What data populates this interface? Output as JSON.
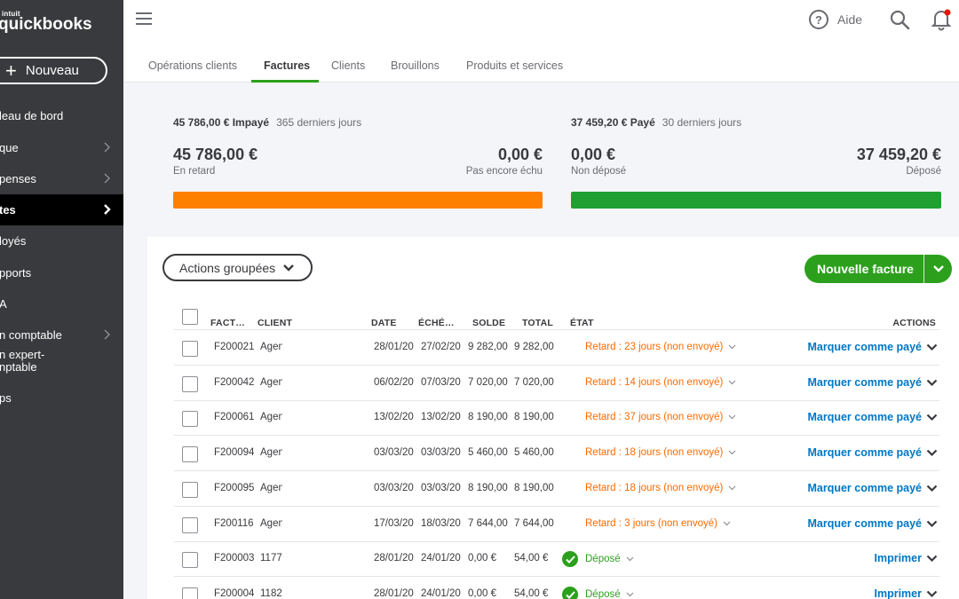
{
  "brand": {
    "intuit": "intuit",
    "name": "quickbooks"
  },
  "new_button": {
    "label": "Nouveau"
  },
  "sidebar": {
    "items": [
      {
        "label": "leau de bord",
        "chevron": false,
        "active": false
      },
      {
        "label": "que",
        "chevron": true,
        "active": false
      },
      {
        "label": "penses",
        "chevron": true,
        "active": false
      },
      {
        "label": "tes",
        "chevron": true,
        "active": true
      },
      {
        "label": "loyés",
        "chevron": false,
        "active": false
      },
      {
        "label": "pports",
        "chevron": false,
        "active": false
      },
      {
        "label": "A",
        "chevron": false,
        "active": false
      },
      {
        "label": "n comptable",
        "chevron": true,
        "active": false
      },
      {
        "label": "n expert-",
        "label2": "nptable",
        "chevron": false,
        "active": false
      },
      {
        "label": "ps",
        "chevron": false,
        "active": false
      }
    ]
  },
  "header": {
    "help_label": "Aide"
  },
  "tabs": [
    {
      "label": "Opérations clients"
    },
    {
      "label": "Factures"
    },
    {
      "label": "Clients"
    },
    {
      "label": "Brouillons"
    },
    {
      "label": "Produits et services"
    }
  ],
  "summary": {
    "unpaid": {
      "total": "45 786,00 € Impayé",
      "period": "365 derniers jours",
      "overdue_amount": "45 786,00 €",
      "overdue_label": "En retard",
      "not_due_amount": "0,00 €",
      "not_due_label": "Pas encore échu",
      "bar_color": "#ff8000"
    },
    "paid": {
      "total": "37 459,20 € Payé",
      "period": "30 derniers jours",
      "not_deposited_amount": "0,00 €",
      "not_deposited_label": "Non déposé",
      "deposited_amount": "37 459,20 €",
      "deposited_label": "Déposé",
      "bar_color": "#21a032"
    }
  },
  "toolbar": {
    "batch_label": "Actions groupées",
    "new_invoice_label": "Nouvelle facture"
  },
  "table": {
    "columns": [
      "FACT…",
      "CLIENT",
      "DATE",
      "ÉCHÉ…",
      "SOLDE",
      "TOTAL",
      "ÉTAT",
      "ACTIONS"
    ],
    "rows": [
      {
        "num": "F200021",
        "client": "Agen",
        "date": "28/01/20",
        "due": "27/02/20",
        "balance": "9 282,00",
        "total": "9 282,00",
        "status": "Retard : 23 jours (non envoyé)",
        "status_type": "late",
        "action": "Marquer comme payé"
      },
      {
        "num": "F200042",
        "client": "Agen",
        "date": "06/02/20",
        "due": "07/03/20",
        "balance": "7 020,00",
        "total": "7 020,00",
        "status": "Retard : 14 jours (non envoyé)",
        "status_type": "late",
        "action": "Marquer comme payé"
      },
      {
        "num": "F200061",
        "client": "Agen",
        "date": "13/02/20",
        "due": "13/02/20",
        "balance": "8 190,00",
        "total": "8 190,00",
        "status": "Retard : 37 jours (non envoyé)",
        "status_type": "late",
        "action": "Marquer comme payé"
      },
      {
        "num": "F200094",
        "client": "Agen",
        "date": "03/03/20",
        "due": "03/03/20",
        "balance": "5 460,00",
        "total": "5 460,00",
        "status": "Retard : 18 jours (non envoyé)",
        "status_type": "late",
        "action": "Marquer comme payé"
      },
      {
        "num": "F200095",
        "client": "Agen",
        "date": "03/03/20",
        "due": "03/03/20",
        "balance": "8 190,00",
        "total": "8 190,00",
        "status": "Retard : 18 jours (non envoyé)",
        "status_type": "late",
        "action": "Marquer comme payé"
      },
      {
        "num": "F200116",
        "client": "Agen",
        "date": "17/03/20",
        "due": "18/03/20",
        "balance": "7 644,00",
        "total": "7 644,00",
        "status": "Retard : 3 jours (non envoyé)",
        "status_type": "late",
        "action": "Marquer comme payé"
      },
      {
        "num": "F200003",
        "client": "1177",
        "date": "28/01/20",
        "due": "24/01/20",
        "balance": "0,00 €",
        "total": "54,00 €",
        "status": "Déposé",
        "status_type": "ok",
        "action": "Imprimer"
      },
      {
        "num": "F200004",
        "client": "1182",
        "date": "28/01/20",
        "due": "24/01/20",
        "balance": "0,00 €",
        "total": "54,00 €",
        "status": "Déposé",
        "status_type": "ok",
        "action": "Imprimer"
      }
    ]
  },
  "icons": {
    "menu": "hamburger-icon",
    "help": "question-circle-icon",
    "search": "search-icon",
    "notifications": "bell-icon",
    "status_ok": "check-circle-icon",
    "expand": "chevron-down-icon"
  },
  "colors": {
    "green": "#2ca01c",
    "orange": "#ff6a00",
    "link": "#0077c5",
    "sidebar": "#393a3d"
  }
}
